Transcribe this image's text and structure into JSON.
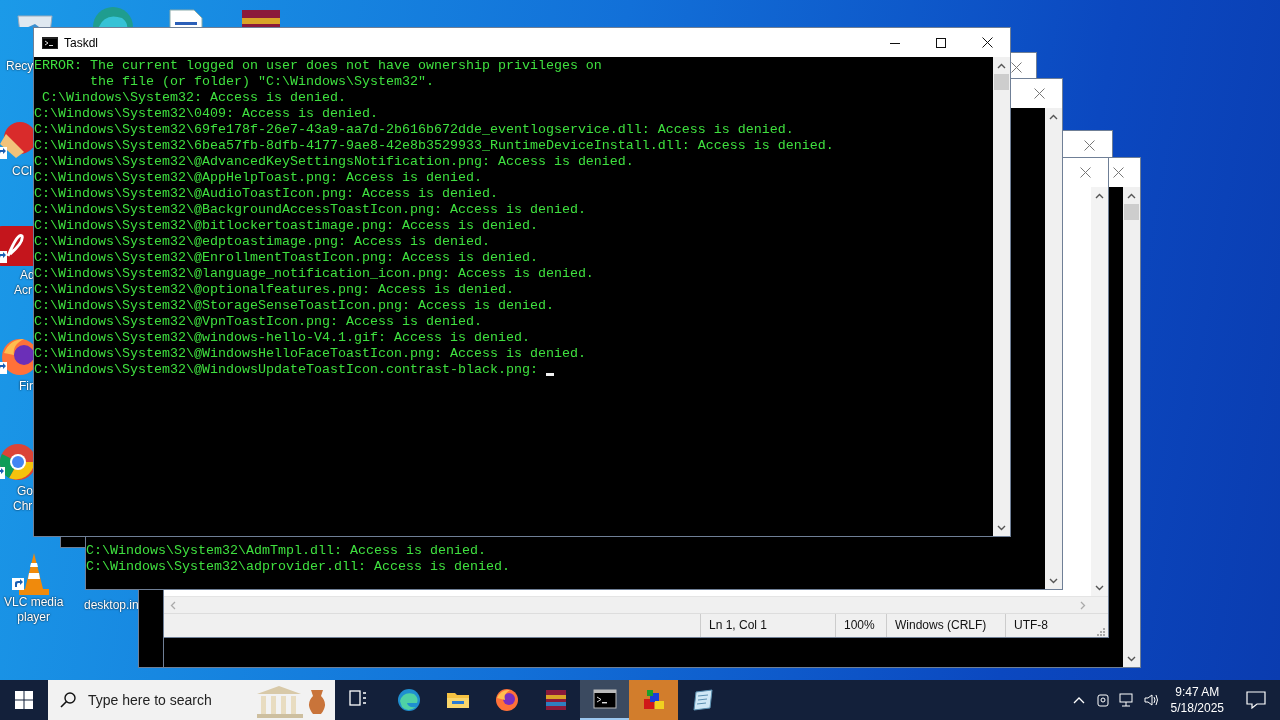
{
  "desktop_icons": [
    {
      "kind": "recycle-bin",
      "label_lines": [
        "Recy"
      ]
    },
    {
      "kind": "edge"
    },
    {
      "kind": "document"
    },
    {
      "kind": "archive"
    },
    {
      "kind": "ccleaner",
      "label_lines": [
        "CCl"
      ]
    },
    {
      "kind": "acrobat",
      "label_lines": [
        "Ad",
        "Acr"
      ]
    },
    {
      "kind": "firefox",
      "label_lines": [
        "Fir"
      ]
    },
    {
      "kind": "chrome",
      "label_lines": [
        "Go",
        "Chr"
      ]
    },
    {
      "kind": "vlc",
      "label_lines": [
        "VLC media",
        "player"
      ]
    },
    {
      "label_lines": [
        "desktop.in"
      ]
    }
  ],
  "background_windows": [
    {
      "kind": "console"
    },
    {
      "kind": "console"
    },
    {
      "kind": "notepad",
      "status_bar": [
        "Ln 1, Col 1",
        "100%",
        "Windows (CRLF)",
        "UTF-8"
      ]
    },
    {
      "kind": "console"
    },
    {
      "kind": "console",
      "lines": [
        "C:\\Windows\\System32\\AdmTmpl.dll: Access is denied.",
        "C:\\Windows\\System32\\adprovider.dll: Access is denied."
      ]
    }
  ],
  "window": {
    "title": "Taskdl",
    "lines": [
      "ERROR: The current logged on user does not have ownership privileges on",
      "       the file (or folder) \"C:\\Windows\\System32\".",
      " C:\\Windows\\System32: Access is denied.",
      "C:\\Windows\\System32\\0409: Access is denied.",
      "C:\\Windows\\System32\\69fe178f-26e7-43a9-aa7d-2b616b672dde_eventlogservice.dll: Access is denied.",
      "C:\\Windows\\System32\\6bea57fb-8dfb-4177-9ae8-42e8b3529933_RuntimeDeviceInstall.dll: Access is denied.",
      "C:\\Windows\\System32\\@AdvancedKeySettingsNotification.png: Access is denied.",
      "C:\\Windows\\System32\\@AppHelpToast.png: Access is denied.",
      "C:\\Windows\\System32\\@AudioToastIcon.png: Access is denied.",
      "C:\\Windows\\System32\\@BackgroundAccessToastIcon.png: Access is denied.",
      "C:\\Windows\\System32\\@bitlockertoastimage.png: Access is denied.",
      "C:\\Windows\\System32\\@edptoastimage.png: Access is denied.",
      "C:\\Windows\\System32\\@EnrollmentToastIcon.png: Access is denied.",
      "C:\\Windows\\System32\\@language_notification_icon.png: Access is denied.",
      "C:\\Windows\\System32\\@optionalfeatures.png: Access is denied.",
      "C:\\Windows\\System32\\@StorageSenseToastIcon.png: Access is denied.",
      "C:\\Windows\\System32\\@VpnToastIcon.png: Access is denied.",
      "C:\\Windows\\System32\\@windows-hello-V4.1.gif: Access is denied.",
      "C:\\Windows\\System32\\@WindowsHelloFaceToastIcon.png: Access is denied.",
      "C:\\Windows\\System32\\@WindowsUpdateToastIcon.contrast-black.png: "
    ],
    "cursor": true
  },
  "taskbar": {
    "search_placeholder": "Type here to search",
    "apps": [
      {
        "kind": "task-view",
        "active": false,
        "flashing": false
      },
      {
        "kind": "edge",
        "active": false,
        "flashing": false
      },
      {
        "kind": "explorer",
        "active": false,
        "flashing": false
      },
      {
        "kind": "firefox",
        "active": false,
        "flashing": false
      },
      {
        "kind": "archive",
        "active": false,
        "flashing": false
      },
      {
        "kind": "console",
        "active": true,
        "flashing": false
      },
      {
        "kind": "installer",
        "active": false,
        "flashing": true
      },
      {
        "kind": "notepad",
        "active": false,
        "flashing": false
      }
    ],
    "clock": {
      "time": "9:47 AM",
      "date": "5/18/2025"
    }
  }
}
